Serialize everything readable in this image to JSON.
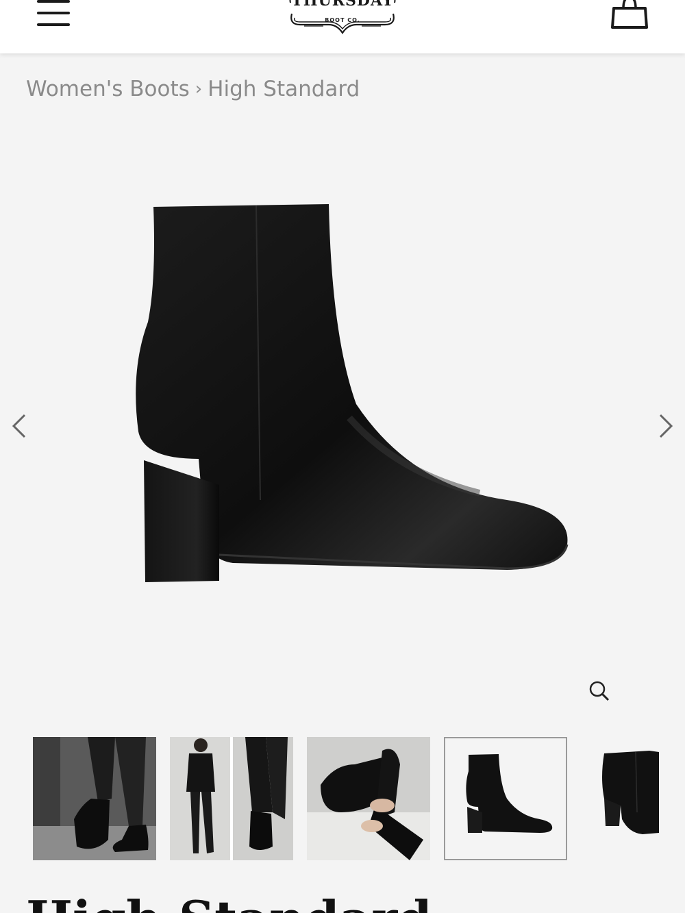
{
  "header": {
    "brand_name": "THURSDAY",
    "brand_sub": "BOOT CO."
  },
  "breadcrumb": {
    "category": "Women's Boots",
    "separator": "›",
    "current": "High Standard"
  },
  "product": {
    "title": "High Standard"
  },
  "icons": {
    "menu": "hamburger-menu-icon",
    "cart": "shopping-bag-icon",
    "prev": "chevron-left-icon",
    "next": "chevron-right-icon",
    "zoom": "magnifier-icon"
  },
  "colors": {
    "page_background": "#f4f4f4",
    "header_background": "#ffffff",
    "breadcrumb_text": "#8a8a8a",
    "boot_leather": "#111111"
  },
  "gallery": {
    "thumbnails": [
      {
        "name": "lifestyle-street-boots"
      },
      {
        "name": "lifestyle-outfit-split"
      },
      {
        "name": "detail-side-zipper"
      },
      {
        "name": "product-side-view"
      },
      {
        "name": "product-angle-view"
      }
    ]
  }
}
